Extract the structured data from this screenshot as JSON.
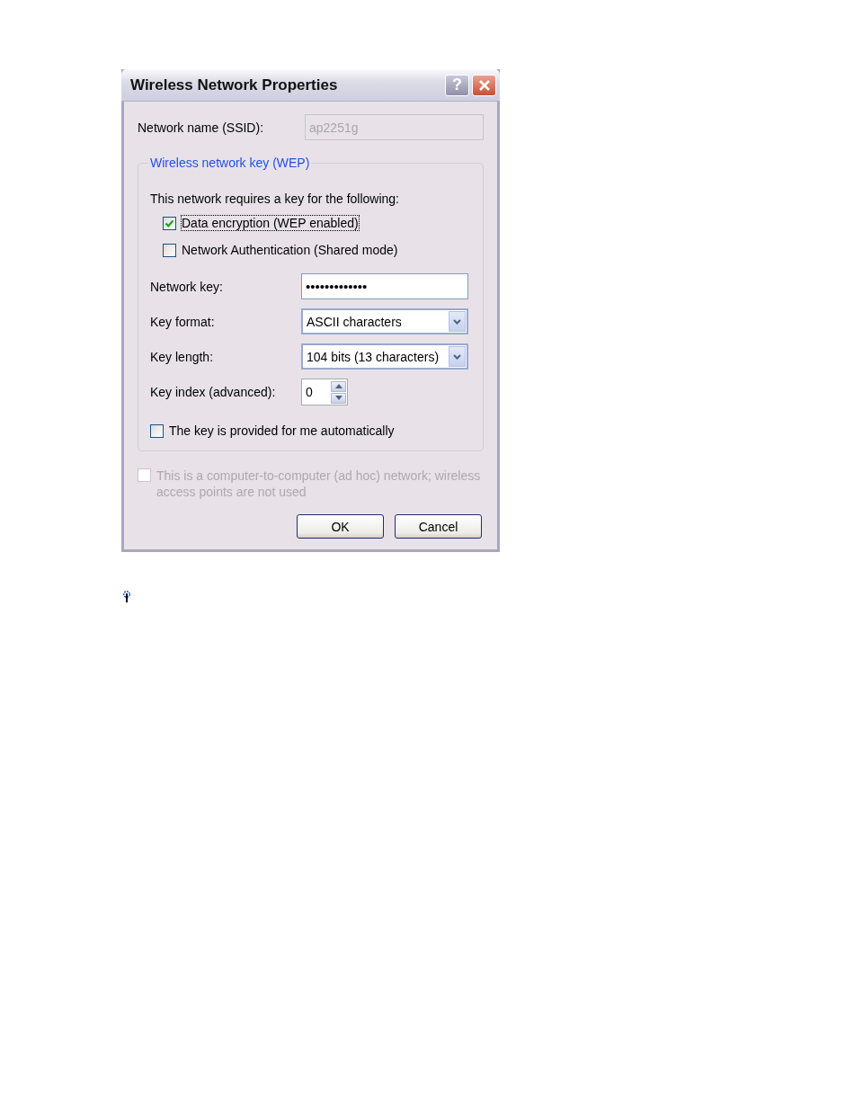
{
  "window": {
    "title": "Wireless Network Properties",
    "help_button": "?"
  },
  "network_name": {
    "label": "Network name (SSID):",
    "value": "ap2251g",
    "disabled": true
  },
  "key_group": {
    "legend": "Wireless network key (WEP)",
    "intro": "This network requires a key for the following:",
    "options": [
      {
        "label": "Data encryption (WEP enabled)",
        "checked": true,
        "focused": true
      },
      {
        "label": "Network Authentication (Shared mode)",
        "checked": false,
        "focused": false
      }
    ],
    "fields": [
      {
        "kind": "password",
        "label": "Network key:",
        "value": "•••••••••••••"
      },
      {
        "kind": "dropdown",
        "label": "Key format:",
        "value": "ASCII characters"
      },
      {
        "kind": "dropdown",
        "label": "Key length:",
        "value": "104 bits (13 characters)"
      },
      {
        "kind": "spinner",
        "label": "Key index (advanced):",
        "value": "0"
      }
    ],
    "auto_key": {
      "label": "The key is provided for me automatically",
      "checked": false
    }
  },
  "adhoc": {
    "label": "This is a computer-to-computer (ad hoc) network; wireless access points are not used",
    "checked": false,
    "disabled": true
  },
  "buttons": [
    "OK",
    "Cancel"
  ]
}
